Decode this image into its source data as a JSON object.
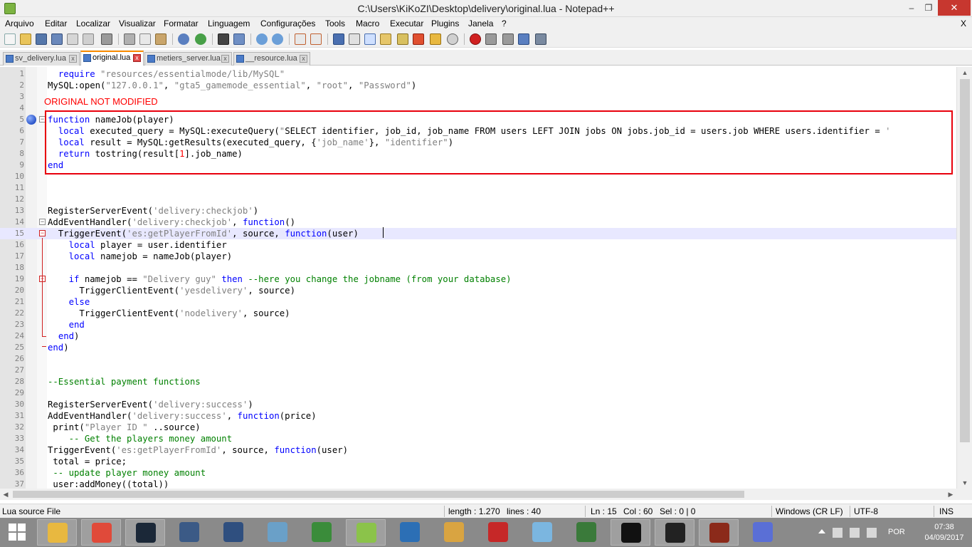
{
  "window": {
    "title": "C:\\Users\\KiKoZI\\Desktop\\delivery\\original.lua - Notepad++",
    "minimize_glyph": "–",
    "maximize_glyph": "❐",
    "close_glyph": "✕"
  },
  "menu": {
    "items": [
      "Arquivo",
      "Editar",
      "Localizar",
      "Visualizar",
      "Formatar",
      "Linguagem",
      "Configurações",
      "Tools",
      "Macro",
      "Executar",
      "Plugins",
      "Janela",
      "?"
    ],
    "close_glyph": "X"
  },
  "toolbar": {
    "buttons": [
      "new-file-icon",
      "open-file-icon",
      "save-icon",
      "save-all-icon",
      "close-icon",
      "close-all-icon",
      "print-icon",
      "cut-icon",
      "copy-icon",
      "paste-icon",
      "undo-icon",
      "redo-icon",
      "find-icon",
      "replace-icon",
      "zoom-in-icon",
      "zoom-out-icon",
      "sync-vertical-icon",
      "sync-horizontal-icon",
      "word-wrap-icon",
      "show-all-chars-icon",
      "indent-guide-icon",
      "user-language-icon",
      "document-map-icon",
      "function-list-icon",
      "folder-as-workspace-icon",
      "monitoring-icon",
      "record-macro-icon",
      "stop-record-icon",
      "play-macro-icon",
      "run-macro-multiple-icon",
      "save-macro-icon"
    ]
  },
  "tabs": [
    {
      "label": "sv_delivery.lua",
      "active": false
    },
    {
      "label": "original.lua",
      "active": true
    },
    {
      "label": "metiers_server.lua",
      "active": false
    },
    {
      "label": "__resource.lua",
      "active": false
    }
  ],
  "editor": {
    "annotation": "ORIGINAL NOT MODIFIED",
    "current_line": 15,
    "lines": [
      {
        "n": "1",
        "t": "  require \"resources/essentialmode/lib/MySQL\""
      },
      {
        "n": "2",
        "t": "MySQL:open(\"127.0.0.1\", \"gta5_gamemode_essential\", \"root\", \"Password\")"
      },
      {
        "n": "3",
        "t": ""
      },
      {
        "n": "4",
        "t": ""
      },
      {
        "n": "5",
        "t": "function nameJob(player)"
      },
      {
        "n": "6",
        "t": "  local executed_query = MySQL:executeQuery(\"SELECT identifier, job_id, job_name FROM users LEFT JOIN jobs ON jobs.job_id = users.job WHERE users.identifier = '"
      },
      {
        "n": "7",
        "t": "  local result = MySQL:getResults(executed_query, {'job_name'}, \"identifier\")"
      },
      {
        "n": "8",
        "t": "  return tostring(result[1].job_name)"
      },
      {
        "n": "9",
        "t": "end"
      },
      {
        "n": "10",
        "t": ""
      },
      {
        "n": "11",
        "t": ""
      },
      {
        "n": "12",
        "t": ""
      },
      {
        "n": "13",
        "t": "RegisterServerEvent('delivery:checkjob')"
      },
      {
        "n": "14",
        "t": "AddEventHandler('delivery:checkjob', function()"
      },
      {
        "n": "15",
        "t": "  TriggerEvent('es:getPlayerFromId', source, function(user)"
      },
      {
        "n": "16",
        "t": "    local player = user.identifier"
      },
      {
        "n": "17",
        "t": "    local namejob = nameJob(player)"
      },
      {
        "n": "18",
        "t": ""
      },
      {
        "n": "19",
        "t": "    if namejob == \"Delivery guy\" then --here you change the jobname (from your database)"
      },
      {
        "n": "20",
        "t": "      TriggerClientEvent('yesdelivery', source)"
      },
      {
        "n": "21",
        "t": "    else"
      },
      {
        "n": "22",
        "t": "      TriggerClientEvent('nodelivery', source)"
      },
      {
        "n": "23",
        "t": "    end"
      },
      {
        "n": "24",
        "t": "  end)"
      },
      {
        "n": "25",
        "t": "end)"
      },
      {
        "n": "26",
        "t": ""
      },
      {
        "n": "27",
        "t": ""
      },
      {
        "n": "28",
        "t": "--Essential payment functions"
      },
      {
        "n": "29",
        "t": ""
      },
      {
        "n": "30",
        "t": "RegisterServerEvent('delivery:success')"
      },
      {
        "n": "31",
        "t": "AddEventHandler('delivery:success', function(price)"
      },
      {
        "n": "32",
        "t": " print(\"Player ID \" ..source)"
      },
      {
        "n": "33",
        "t": "    -- Get the players money amount"
      },
      {
        "n": "34",
        "t": "TriggerEvent('es:getPlayerFromId', source, function(user)"
      },
      {
        "n": "35",
        "t": " total = price;"
      },
      {
        "n": "36",
        "t": " -- update player money amount"
      },
      {
        "n": "37",
        "t": " user:addMoney((total))"
      }
    ]
  },
  "statusbar": {
    "file_type": "Lua source File",
    "length": "length : 1.270",
    "lines": "lines : 40",
    "ln": "Ln : 15",
    "col": "Col : 60",
    "sel": "Sel : 0 | 0",
    "eol": "Windows (CR LF)",
    "encoding": "UTF-8",
    "mode": "INS"
  },
  "taskbar": {
    "apps": [
      {
        "name": "file-explorer-icon",
        "color": "#e8b840"
      },
      {
        "name": "chrome-icon",
        "color": "#e04a3a"
      },
      {
        "name": "steam-icon",
        "color": "#1b2838"
      },
      {
        "name": "teamspeak-icon",
        "color": "#3b5a86"
      },
      {
        "name": "media-player-icon",
        "color": "#2f4f7f"
      },
      {
        "name": "calculator-icon",
        "color": "#6aa0c8"
      },
      {
        "name": "internet-download-manager-icon",
        "color": "#3a8c3a"
      },
      {
        "name": "notepad-plus-plus-icon",
        "color": "#8bc34a"
      },
      {
        "name": "remote-desktop-icon",
        "color": "#2c6fb5"
      },
      {
        "name": "paint-icon",
        "color": "#d9a441"
      },
      {
        "name": "filezilla-icon",
        "color": "#c62828"
      },
      {
        "name": "notebook-icon",
        "color": "#7bb6e0"
      },
      {
        "name": "hotspot-shield-icon",
        "color": "#3a7a3a"
      },
      {
        "name": "powershell-icon",
        "color": "#111111"
      },
      {
        "name": "command-prompt-icon",
        "color": "#222222"
      },
      {
        "name": "game-launcher-icon",
        "color": "#8b2a1a"
      },
      {
        "name": "discord-icon",
        "color": "#5a6fd6"
      }
    ],
    "language": "POR",
    "time": "07:38",
    "date": "04/09/2017"
  }
}
